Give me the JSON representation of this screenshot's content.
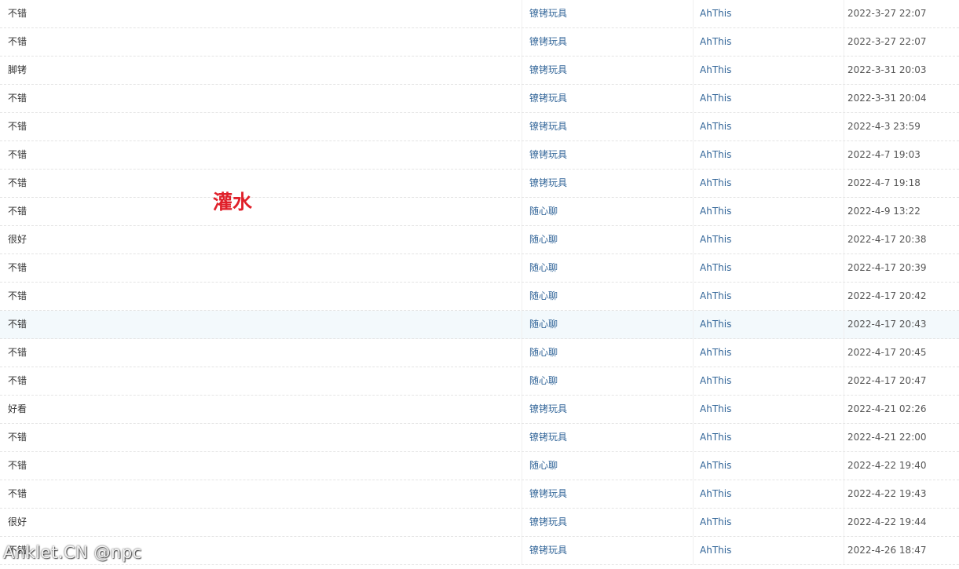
{
  "rows": [
    {
      "title": "不错",
      "forum": "镣铐玩具",
      "author": "AhThis",
      "time": "2022-3-27 22:07"
    },
    {
      "title": "不错",
      "forum": "镣铐玩具",
      "author": "AhThis",
      "time": "2022-3-27 22:07"
    },
    {
      "title": "脚铐",
      "forum": "镣铐玩具",
      "author": "AhThis",
      "time": "2022-3-31 20:03"
    },
    {
      "title": "不错",
      "forum": "镣铐玩具",
      "author": "AhThis",
      "time": "2022-3-31 20:04"
    },
    {
      "title": "不错",
      "forum": "镣铐玩具",
      "author": "AhThis",
      "time": "2022-4-3 23:59"
    },
    {
      "title": "不错",
      "forum": "镣铐玩具",
      "author": "AhThis",
      "time": "2022-4-7 19:03"
    },
    {
      "title": "不错",
      "forum": "镣铐玩具",
      "author": "AhThis",
      "time": "2022-4-7 19:18"
    },
    {
      "title": "不错",
      "forum": "随心聊",
      "author": "AhThis",
      "time": "2022-4-9 13:22"
    },
    {
      "title": "很好",
      "forum": "随心聊",
      "author": "AhThis",
      "time": "2022-4-17 20:38"
    },
    {
      "title": "不错",
      "forum": "随心聊",
      "author": "AhThis",
      "time": "2022-4-17 20:39"
    },
    {
      "title": "不错",
      "forum": "随心聊",
      "author": "AhThis",
      "time": "2022-4-17 20:42"
    },
    {
      "title": "不错",
      "forum": "随心聊",
      "author": "AhThis",
      "time": "2022-4-17 20:43"
    },
    {
      "title": "不错",
      "forum": "随心聊",
      "author": "AhThis",
      "time": "2022-4-17 20:45"
    },
    {
      "title": "不错",
      "forum": "随心聊",
      "author": "AhThis",
      "time": "2022-4-17 20:47"
    },
    {
      "title": "好看",
      "forum": "镣铐玩具",
      "author": "AhThis",
      "time": "2022-4-21 02:26"
    },
    {
      "title": "不错",
      "forum": "镣铐玩具",
      "author": "AhThis",
      "time": "2022-4-21 22:00"
    },
    {
      "title": "不错",
      "forum": "随心聊",
      "author": "AhThis",
      "time": "2022-4-22 19:40"
    },
    {
      "title": "不错",
      "forum": "镣铐玩具",
      "author": "AhThis",
      "time": "2022-4-22 19:43"
    },
    {
      "title": "很好",
      "forum": "镣铐玩具",
      "author": "AhThis",
      "time": "2022-4-22 19:44"
    },
    {
      "title": "不错",
      "forum": "镣铐玩具",
      "author": "AhThis",
      "time": "2022-4-26 18:47"
    }
  ],
  "highlighted_row": 11,
  "annotation": {
    "text": "灌水",
    "color": "#e0202a"
  },
  "watermark": {
    "text": "Anklet.CN @npc"
  },
  "colors": {
    "link": "#336699",
    "text": "#333333",
    "highlight_bg": "#f3f9fc"
  }
}
